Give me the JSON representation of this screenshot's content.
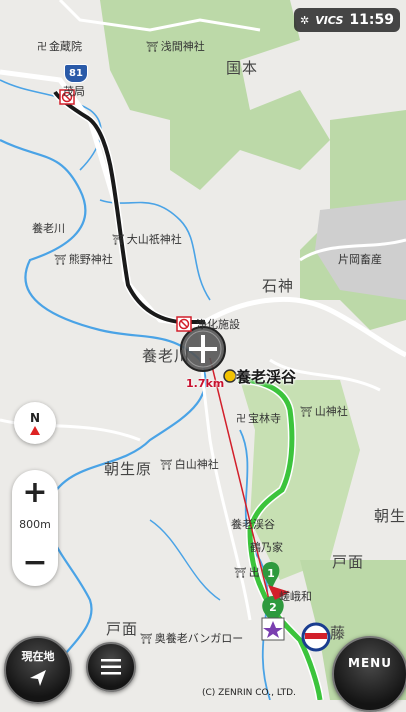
{
  "status_bar": {
    "vics": "VICS",
    "time": "11:59"
  },
  "route_number": "81",
  "colors": {
    "land": "#ecebe8",
    "green_area": "#bcd9a8",
    "river": "#4aa3e6",
    "road": "#ffffff",
    "route_black": "#1a1a1a",
    "route_green": "#3cc43c",
    "guide_line": "#d21f2a",
    "destination_dot": "#f2c200"
  },
  "labels": {
    "konzoin": "金蔵院",
    "asama_jinja": "浅間神社",
    "kokumoto": "国本",
    "post_office": "茂局",
    "yoro_river_1": "養老川",
    "oyamazumi_jinja": "大山祇神社",
    "kumano_jinja": "熊野神社",
    "kataoka": "片岡畜産",
    "ishigami": "石神",
    "purification": "浄化施設",
    "yoro_river_2": "養老川",
    "distance": "1.7km",
    "yoro_keikoku": "養老渓谷",
    "hourinji": "宝林寺",
    "yama_jinja": "山神社",
    "asaobara": "朝生原",
    "shirayama_jinja": "白山神社",
    "asao": "朝生",
    "yoro_keikoku_2": "養老渓谷",
    "tsurunoya": "鶴乃家",
    "tomo": "戸面",
    "idezawa": "出",
    "sagawa": "嵯峨和",
    "tomo_2": "戸面",
    "bungalow": "奥養老バンガロー",
    "fuji": "藤"
  },
  "controls": {
    "north_label": "N",
    "zoom_in": "+",
    "zoom_out": "−",
    "scale": "800m",
    "current_location": "現在地",
    "menu": "MENU"
  },
  "waypoints": {
    "first": "1",
    "second": "2"
  },
  "icons": [
    "shrine-icon",
    "temple-icon",
    "no-entry-icon",
    "compass-icon",
    "zoom-cursor-icon",
    "list-icon",
    "arrow-icon",
    "goal-flag-icon"
  ],
  "copyright": "(C) ZENRIN CO., LTD."
}
